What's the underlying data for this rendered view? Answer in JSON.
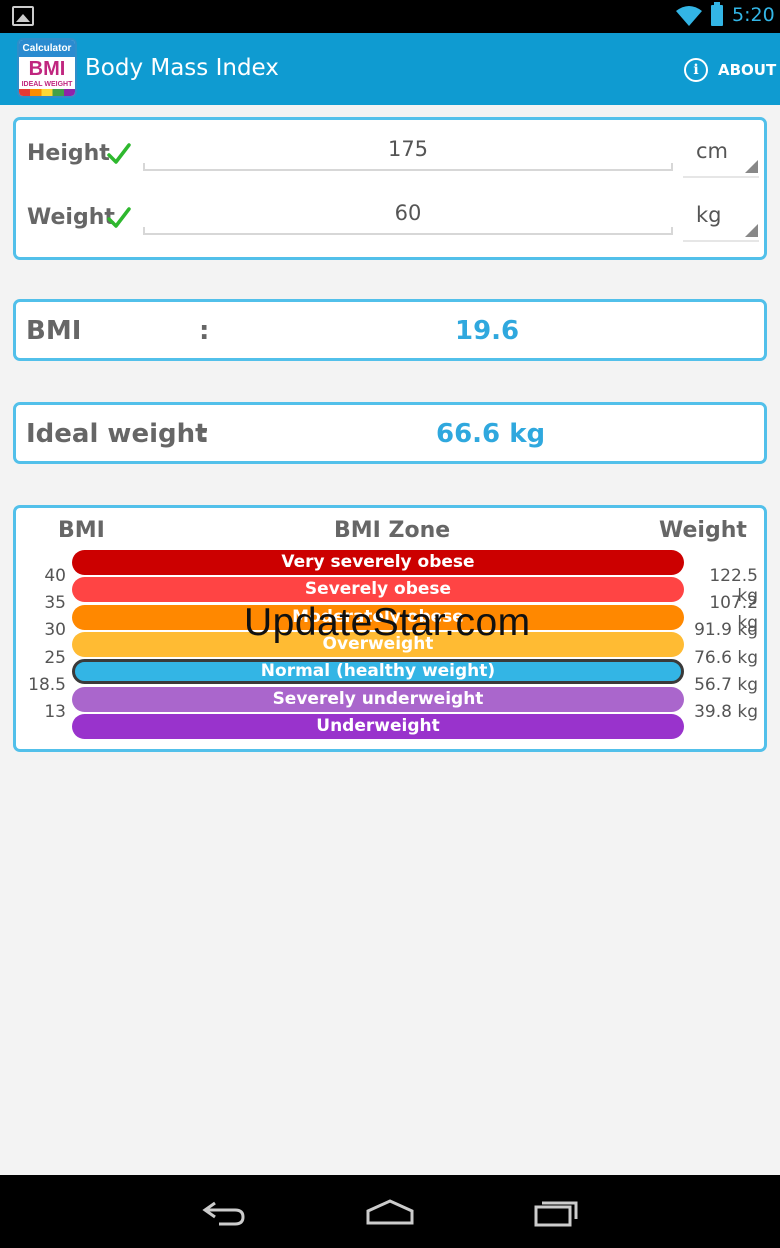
{
  "status_bar": {
    "time": "5:20"
  },
  "app": {
    "icon_top": "Calculator",
    "icon_mid": "BMI",
    "icon_bot": "IDEAL WEIGHT",
    "title": "Body Mass Index",
    "about_label": "ABOUT"
  },
  "inputs": {
    "height": {
      "label": "Height",
      "value": "175",
      "unit": "cm"
    },
    "weight": {
      "label": "Weight",
      "value": "60",
      "unit": "kg"
    }
  },
  "results": {
    "bmi": {
      "label": "BMI",
      "colon": ":",
      "value": "19.6"
    },
    "ideal": {
      "label": "Ideal weight",
      "colon": ":",
      "value": "66.6 kg"
    }
  },
  "zones": {
    "header_bmi": "BMI",
    "header_zone": "BMI Zone",
    "header_weight": "Weight",
    "bars": [
      {
        "label": "Very severely obese",
        "color": "#cc0000"
      },
      {
        "label": "Severely obese",
        "color": "#ff4444"
      },
      {
        "label": "Moderately obese",
        "color": "#ff8800"
      },
      {
        "label": "Overweight",
        "color": "#ffbb33"
      },
      {
        "label": "Normal (healthy weight)",
        "color": "#33b5e5",
        "selected": true
      },
      {
        "label": "Severely underweight",
        "color": "#aa66cc"
      },
      {
        "label": "Underweight",
        "color": "#9933cc"
      }
    ],
    "bmi_thresholds": [
      "40",
      "35",
      "30",
      "25",
      "18.5",
      "13"
    ],
    "weight_thresholds": [
      "122.5 kg",
      "107.2 kg",
      "91.9 kg",
      "76.6 kg",
      "56.7 kg",
      "39.8 kg"
    ]
  },
  "watermark": "UpdateStar.com",
  "icons": {
    "gallery": "gallery-icon",
    "wifi": "wifi-icon",
    "battery": "battery-icon",
    "info": "info-icon",
    "check": "checkmark-icon",
    "back": "back-icon",
    "home": "home-icon",
    "recents": "recents-icon"
  }
}
